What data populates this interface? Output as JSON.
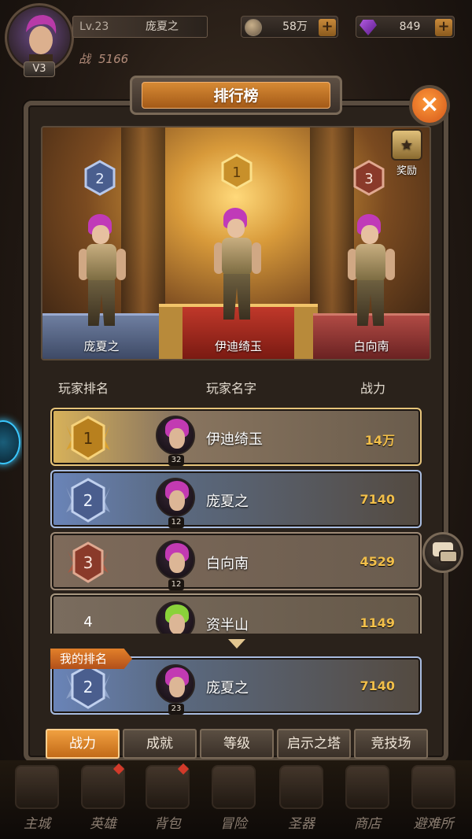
{
  "player": {
    "level": "Lv.23",
    "name": "庞夏之",
    "vip": "V3",
    "power_label": "战",
    "power": "5166"
  },
  "resources": {
    "gold": "58万",
    "gems": "849",
    "plus": "+"
  },
  "panel": {
    "title": "排行榜",
    "close": "×",
    "reward_label": "奖励"
  },
  "podium": {
    "first": {
      "rank": "1",
      "name": "伊迪绮玉"
    },
    "second": {
      "rank": "2",
      "name": "庞夏之"
    },
    "third": {
      "rank": "3",
      "name": "白向南"
    }
  },
  "table": {
    "headers": {
      "rank": "玩家排名",
      "name": "玩家名字",
      "power": "战力"
    },
    "rows": [
      {
        "rank": "1",
        "name": "伊迪绮玉",
        "level": "32",
        "power": "14万"
      },
      {
        "rank": "2",
        "name": "庞夏之",
        "level": "12",
        "power": "7140"
      },
      {
        "rank": "3",
        "name": "白向南",
        "level": "12",
        "power": "4529"
      },
      {
        "rank": "4",
        "name": "资半山",
        "level": "",
        "power": "1149"
      }
    ]
  },
  "my_rank": {
    "tag": "我的排名",
    "rank": "2",
    "name": "庞夏之",
    "level": "23",
    "power": "7140"
  },
  "tabs": [
    "战力",
    "成就",
    "等级",
    "启示之塔",
    "竞技场"
  ],
  "nav": [
    "主城",
    "英雄",
    "背包",
    "冒险",
    "圣器",
    "商店",
    "避难所"
  ],
  "colors": {
    "accent_orange": "#e2802a",
    "power_text": "#f2bf4a",
    "gold_badge": "#d8a030",
    "silver_badge": "#5a6e9a",
    "bronze_badge": "#8a3a2a"
  }
}
